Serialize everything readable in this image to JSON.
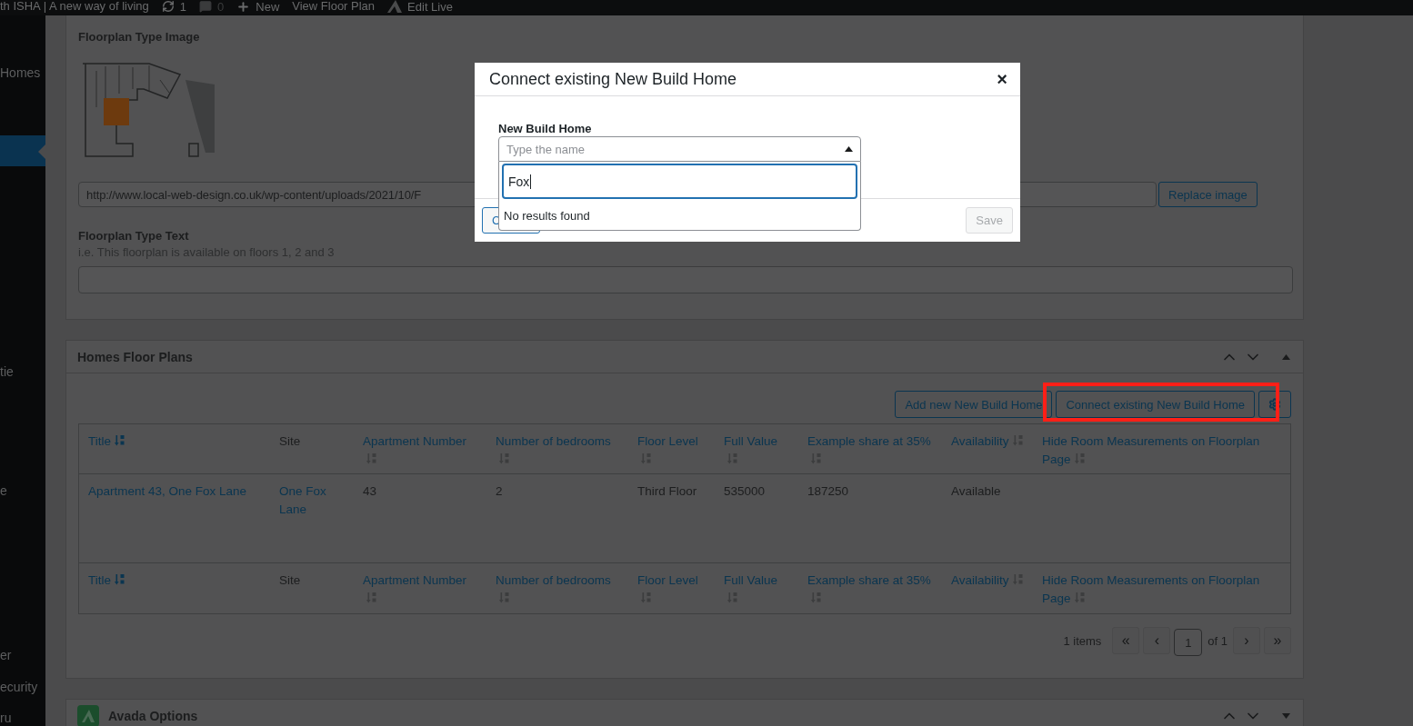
{
  "admin_bar": {
    "site_name": "th ISHA | A new way of living",
    "updates": "1",
    "comments": "0",
    "new": "New",
    "view": "View Floor Plan",
    "edit_live": "Edit Live"
  },
  "sidebar": {
    "items": [
      {
        "label": "Homes",
        "selected": false
      },
      {
        "selected": true
      },
      {
        "label": "tie",
        "selected": false
      },
      {
        "label": "e",
        "selected": false
      },
      {
        "label": "er",
        "selected": false
      },
      {
        "label": "ecurity",
        "selected": false
      },
      {
        "label": "ru",
        "selected": false
      }
    ]
  },
  "floorplan_panel": {
    "image_label": "Floorplan Type Image",
    "image_url": "http://www.local-web-design.co.uk/wp-content/uploads/2021/10/F",
    "replace_button": "Replace image",
    "text_label": "Floorplan Type Text",
    "text_hint": "i.e. This floorplan is available on floors 1, 2 and 3"
  },
  "homes_panel": {
    "title": "Homes Floor Plans",
    "expanded": true,
    "buttons": [
      {
        "kind": "text",
        "label": "Add new New Build Home",
        "highlighted": false
      },
      {
        "kind": "text",
        "label": "Connect existing New Build Home",
        "highlighted": true
      },
      {
        "kind": "gear",
        "highlighted": false
      }
    ],
    "columns": [
      {
        "label": "Title",
        "sortable": true,
        "sorted": true
      },
      {
        "label": "Site",
        "sortable": false
      },
      {
        "label": "Apartment Number",
        "sortable": true,
        "sorted": false
      },
      {
        "label": "Number of bedrooms",
        "sortable": true,
        "sorted": false
      },
      {
        "label": "Floor Level",
        "sortable": true,
        "sorted": false
      },
      {
        "label": "Full Value",
        "sortable": true,
        "sorted": false
      },
      {
        "label": "Example share at 35%",
        "sortable": true,
        "sorted": false
      },
      {
        "label": "Availability",
        "sortable": true,
        "sorted": false
      },
      {
        "label": "Hide Room Measurements on Floorplan Page",
        "sortable": true,
        "sorted": false
      }
    ],
    "rows": [
      [
        {
          "kind": "link",
          "text": "Apartment 43, One Fox Lane"
        },
        {
          "kind": "link",
          "text": "One Fox Lane"
        },
        {
          "kind": "text",
          "text": "43"
        },
        {
          "kind": "text",
          "text": "2"
        },
        {
          "kind": "text",
          "text": "Third Floor"
        },
        {
          "kind": "text",
          "text": "535000"
        },
        {
          "kind": "text",
          "text": "187250"
        },
        {
          "kind": "text",
          "text": "Available"
        }
      ]
    ],
    "footer_columns": [
      {
        "label": "Title",
        "sortable": true,
        "sorted": true
      },
      {
        "label": "Site",
        "sortable": false
      },
      {
        "label": "Apartment Number",
        "sortable": true,
        "sorted": false
      },
      {
        "label": "Number of bedrooms",
        "sortable": true,
        "sorted": false
      },
      {
        "label": "Floor Level",
        "sortable": true,
        "sorted": false
      },
      {
        "label": "Full Value",
        "sortable": true,
        "sorted": false
      },
      {
        "label": "Example share at 35%",
        "sortable": true,
        "sorted": false
      },
      {
        "label": "Availability",
        "sortable": true,
        "sorted": false
      },
      {
        "label": "Hide Room Measurements on Floorplan Page",
        "sortable": true,
        "sorted": false
      }
    ],
    "pagination": {
      "count": "1 items",
      "first": "«",
      "prev": "‹",
      "page": "1",
      "of": "of 1",
      "next": "›",
      "last": "»"
    }
  },
  "avada_panel": {
    "title": "Avada Options",
    "expanded": false
  },
  "modal": {
    "title": "Connect existing New Build Home",
    "close": "×",
    "field_label": "New Build Home",
    "placeholder": "Type the name",
    "dropdown_open": true,
    "search_value": "Fox",
    "no_results": "No results found",
    "cancel": "C",
    "save": "Save",
    "save_disabled": true
  }
}
